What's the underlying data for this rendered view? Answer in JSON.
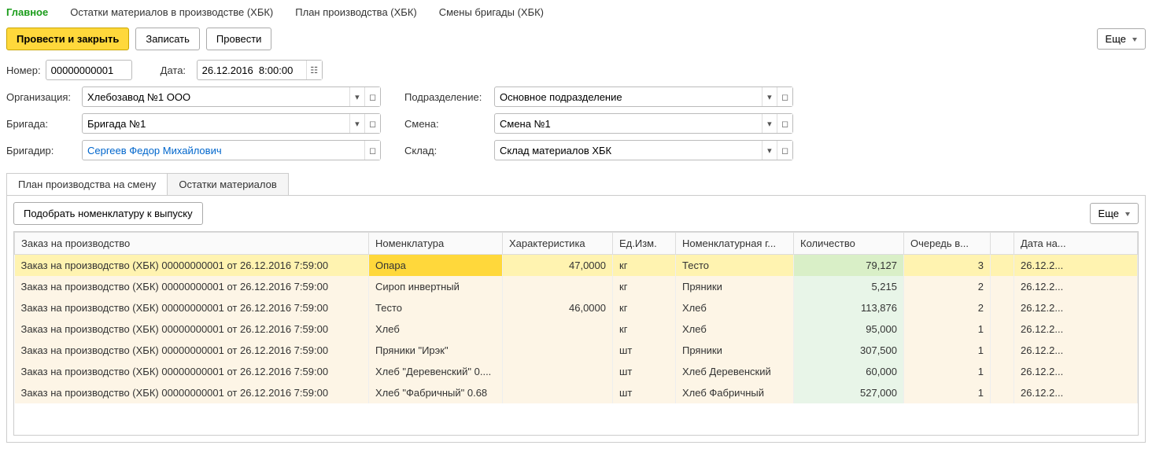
{
  "topTabs": {
    "main": "Главное",
    "remains": "Остатки материалов в производстве (ХБК)",
    "plan": "План производства (ХБК)",
    "shifts": "Смены бригады (ХБК)"
  },
  "toolbar": {
    "postClose": "Провести и закрыть",
    "write": "Записать",
    "post": "Провести",
    "more": "Еще"
  },
  "fields": {
    "numberLabel": "Номер:",
    "numberValue": "00000000001",
    "dateLabel": "Дата:",
    "dateValue": "26.12.2016  8:00:00",
    "orgLabel": "Организация:",
    "orgValue": "Хлебозавод №1 ООО",
    "subdivLabel": "Подразделение:",
    "subdivValue": "Основное подразделение",
    "brigadeLabel": "Бригада:",
    "brigadeValue": "Бригада №1",
    "shiftLabel": "Смена:",
    "shiftValue": "Смена №1",
    "brigadierLabel": "Бригадир:",
    "brigadierValue": "Сергеев Федор Михайлович",
    "warehouseLabel": "Склад:",
    "warehouseValue": "Склад материалов ХБК"
  },
  "subTabs": {
    "plan": "План производства на смену",
    "remains": "Остатки материалов"
  },
  "tabToolbar": {
    "pick": "Подобрать номенклатуру к выпуску",
    "more": "Еще"
  },
  "columns": {
    "order": "Заказ на производство",
    "nomen": "Номенклатура",
    "char": "Характеристика",
    "unit": "Ед.Изм.",
    "group": "Номенклатурная г...",
    "qty": "Количество",
    "queue": "Очередь в...",
    "date": "Дата на..."
  },
  "rows": [
    {
      "order": "Заказ на производство (ХБК) 00000000001 от 26.12.2016 7:59:00",
      "nomen": "Опара",
      "char": "47,0000",
      "unit": "кг",
      "group": "Тесто",
      "qty": "79,127",
      "queue": "3",
      "date": "26.12.2..."
    },
    {
      "order": "Заказ на производство (ХБК) 00000000001 от 26.12.2016 7:59:00",
      "nomen": "Сироп инвертный",
      "char": "",
      "unit": "кг",
      "group": "Пряники",
      "qty": "5,215",
      "queue": "2",
      "date": "26.12.2..."
    },
    {
      "order": "Заказ на производство (ХБК) 00000000001 от 26.12.2016 7:59:00",
      "nomen": "Тесто",
      "char": "46,0000",
      "unit": "кг",
      "group": "Хлеб",
      "qty": "113,876",
      "queue": "2",
      "date": "26.12.2..."
    },
    {
      "order": "Заказ на производство (ХБК) 00000000001 от 26.12.2016 7:59:00",
      "nomen": "Хлеб",
      "char": "",
      "unit": "кг",
      "group": "Хлеб",
      "qty": "95,000",
      "queue": "1",
      "date": "26.12.2..."
    },
    {
      "order": "Заказ на производство (ХБК) 00000000001 от 26.12.2016 7:59:00",
      "nomen": "Пряники \"Ирэк\"",
      "char": "",
      "unit": "шт",
      "group": "Пряники",
      "qty": "307,500",
      "queue": "1",
      "date": "26.12.2..."
    },
    {
      "order": "Заказ на производство (ХБК) 00000000001 от 26.12.2016 7:59:00",
      "nomen": "Хлеб \"Деревенский\" 0....",
      "char": "",
      "unit": "шт",
      "group": "Хлеб Деревенский",
      "qty": "60,000",
      "queue": "1",
      "date": "26.12.2..."
    },
    {
      "order": "Заказ на производство (ХБК) 00000000001 от 26.12.2016 7:59:00",
      "nomen": "Хлеб \"Фабричный\" 0.68",
      "char": "",
      "unit": "шт",
      "group": "Хлеб Фабричный",
      "qty": "527,000",
      "queue": "1",
      "date": "26.12.2..."
    }
  ]
}
